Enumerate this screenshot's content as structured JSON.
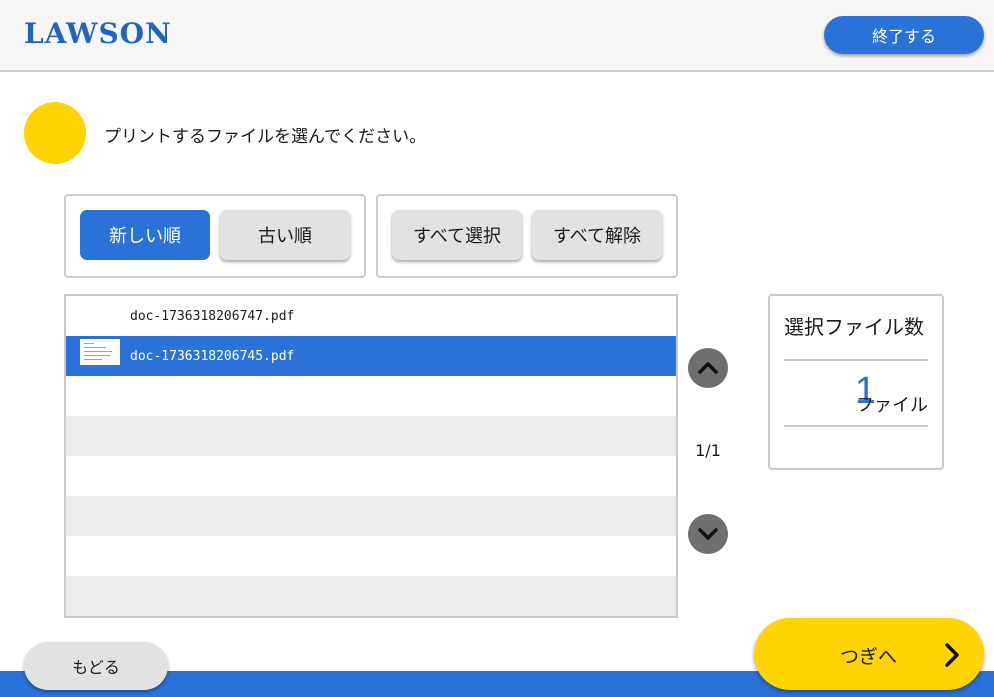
{
  "header": {
    "logo": "LAWSON",
    "exit_label": "終了する"
  },
  "instruction": "プリントするファイルを選んでください。",
  "sort_buttons": {
    "newest_label": "新しい順",
    "oldest_label": "古い順",
    "active": "newest"
  },
  "select_buttons": {
    "select_all_label": "すべて選択",
    "deselect_all_label": "すべて解除"
  },
  "files": [
    {
      "name": "doc-1736318206747.pdf",
      "selected": false
    },
    {
      "name": "doc-1736318206745.pdf",
      "selected": true
    }
  ],
  "pagination": {
    "indicator": "1/1",
    "up_icon": "chevron-up-icon",
    "down_icon": "chevron-down-icon"
  },
  "selection_count": {
    "title": "選択ファイル数",
    "count": "1",
    "unit": "ファイル"
  },
  "footer": {
    "back_label": "もどる",
    "next_label": "つぎへ",
    "next_icon": "chevron-right-icon"
  },
  "colors": {
    "brand_blue": "#2a72d8",
    "accent_yellow": "#ffd400",
    "button_gray": "#e2e2e2"
  }
}
